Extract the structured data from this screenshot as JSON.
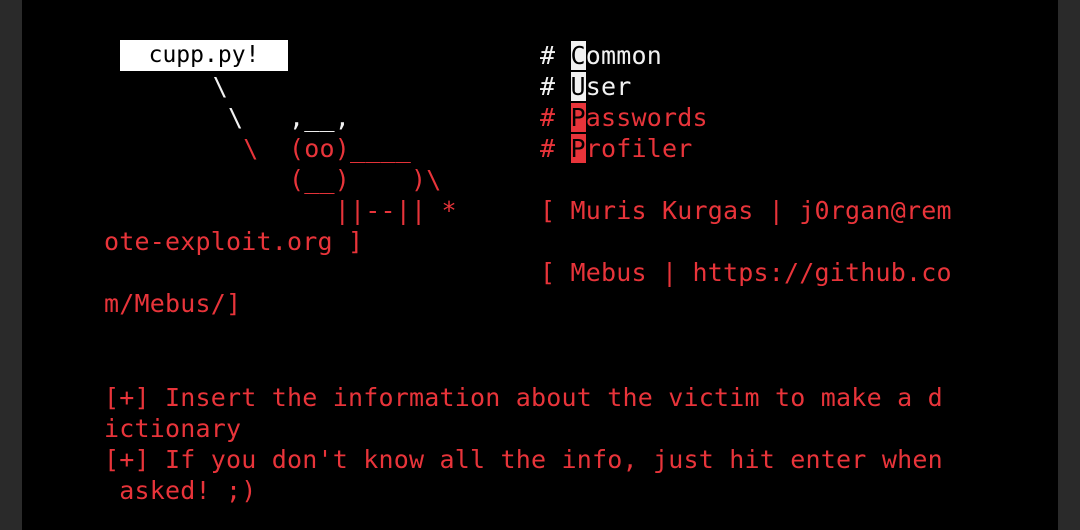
{
  "banner": {
    "speech": "cupp.py!",
    "art": [
      "       \\",
      "        \\   ,__,",
      "         \\  (oo)____",
      "            (__)    )\\",
      "               ||--|| *"
    ]
  },
  "menu": {
    "items": [
      {
        "hash": "# ",
        "first": "C",
        "rest": "ommon"
      },
      {
        "hash": "# ",
        "first": "U",
        "rest": "ser"
      },
      {
        "hash": "# ",
        "first": "P",
        "rest": "asswords"
      },
      {
        "hash": "# ",
        "first": "P",
        "rest": "rofiler"
      }
    ]
  },
  "credits": {
    "line1": "[ Muris Kurgas | j0rgan@rem",
    "line1_cont": "ote-exploit.org ]",
    "line2": "[ Mebus | https://github.co",
    "line2_cont": "m/Mebus/]"
  },
  "messages": [
    "[+] Insert the information about the victim to make a d",
    "ictionary",
    "[+] If you don't know all the info, just hit enter when",
    " asked! ;)"
  ],
  "colors": {
    "terminal_bg": "#000000",
    "text_red": "#e8343a",
    "text_white": "#f2f2f2"
  }
}
